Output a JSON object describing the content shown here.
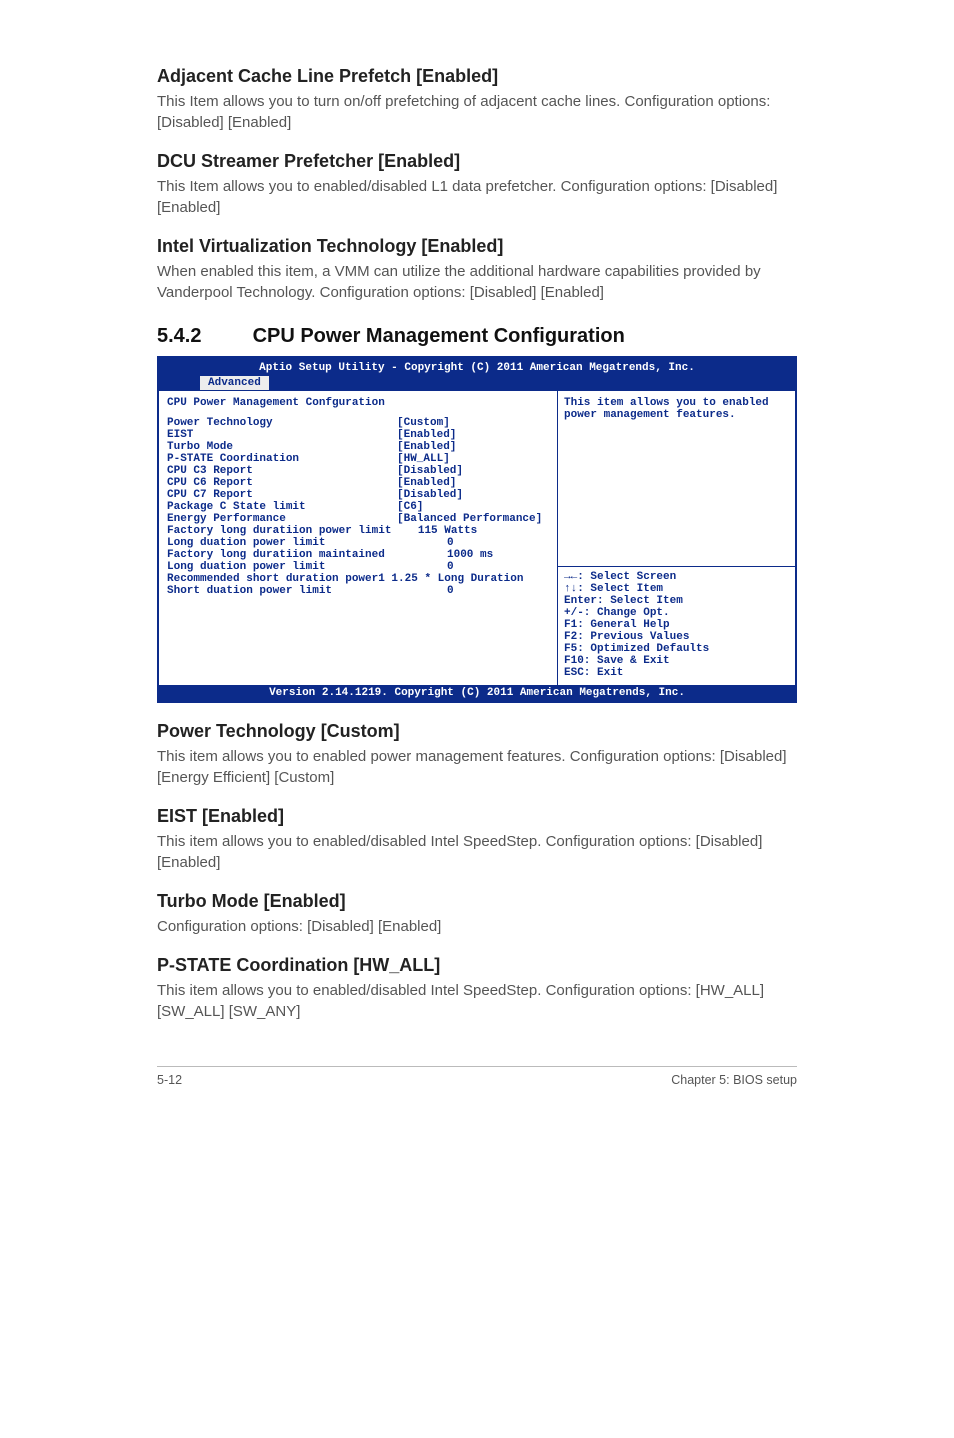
{
  "sections": {
    "s1": {
      "title": "Adjacent Cache Line Prefetch [Enabled]",
      "desc": "This Item allows you to turn on/off prefetching of adjacent cache lines.\nConfiguration options: [Disabled] [Enabled]"
    },
    "s2": {
      "title": "DCU Streamer Prefetcher [Enabled]",
      "desc": "This Item allows you to enabled/disabled L1 data prefetcher.\nConfiguration options: [Disabled] [Enabled]"
    },
    "s3": {
      "title": "Intel Virtualization Technology [Enabled]",
      "desc": "When enabled this item, a VMM can utilize the additional hardware capabilities provided by Vanderpool Technology.\nConfiguration options: [Disabled] [Enabled]"
    },
    "sec_num": "5.4.2",
    "sec_title": "CPU Power Management Configuration",
    "s4": {
      "title": "Power Technology [Custom]",
      "desc": "This item allows you to enabled power management features.\nConfiguration options: [Disabled] [Energy Efficient] [Custom]"
    },
    "s5": {
      "title": "EIST [Enabled]",
      "desc": "This item allows you to enabled/disabled Intel SpeedStep.\nConfiguration options: [Disabled] [Enabled]"
    },
    "s6": {
      "title": "Turbo Mode [Enabled]",
      "desc": "Configuration options: [Disabled] [Enabled]"
    },
    "s7": {
      "title": "P-STATE Coordination [HW_ALL]",
      "desc": "This item allows you to enabled/disabled Intel SpeedStep.\nConfiguration options: [HW_ALL] [SW_ALL] [SW_ANY]"
    }
  },
  "bios": {
    "top_title": "Aptio Setup Utility - Copyright (C) 2011 American Megatrends, Inc.",
    "tab": "Advanced",
    "list_title": "CPU Power Management Confguration",
    "rows": [
      {
        "label": "Power Technology",
        "val": "[Custom]"
      },
      {
        "label": "EIST",
        "val": "[Enabled]"
      },
      {
        "label": "Turbo Mode",
        "val": "[Enabled]"
      },
      {
        "label": "P-STATE Coordination",
        "val": "[HW_ALL]"
      },
      {
        "label": "CPU C3 Report",
        "val": "[Disabled]"
      },
      {
        "label": "CPU C6 Report",
        "val": "[Enabled]"
      },
      {
        "label": "CPU C7 Report",
        "val": "[Disabled]"
      },
      {
        "label": "Package C State limit",
        "val": "[C6]"
      },
      {
        "label": "Energy Performance",
        "val": "[Balanced Performance]"
      }
    ],
    "line_factory_power": "Factory long duratiion power limit    115 Watts",
    "rows2": [
      {
        "label": "Long duation power limit",
        "val": "0"
      },
      {
        "label": "Factory long duratiion maintained",
        "val": "1000 ms"
      },
      {
        "label": "Long duation power limit",
        "val": "0"
      }
    ],
    "line_recommended": "Recommended short duration power1 1.25 * Long Duration",
    "row_short": {
      "label": "Short duation power limit",
      "val": "0"
    },
    "help_text": "This item allows you to enabled power management features.",
    "nav": [
      "→←: Select Screen",
      "↑↓:  Select Item",
      "Enter: Select Item",
      "+/-: Change Opt.",
      "F1: General Help",
      "F2: Previous Values",
      "F5: Optimized Defaults",
      "F10: Save & Exit",
      "ESC: Exit"
    ],
    "footer": "Version 2.14.1219. Copyright (C) 2011 American Megatrends, Inc."
  },
  "page_footer": {
    "left": "5-12",
    "right": "Chapter 5: BIOS setup"
  }
}
